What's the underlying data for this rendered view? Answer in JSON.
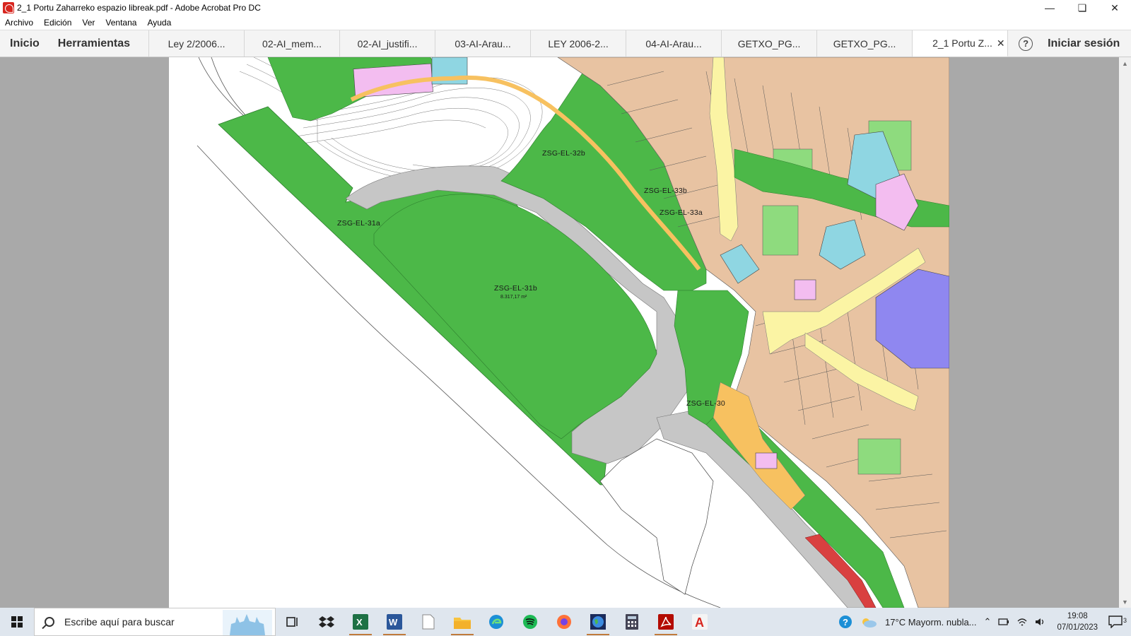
{
  "window": {
    "title": "2_1 Portu Zaharreko espazio libreak.pdf - Adobe Acrobat Pro DC"
  },
  "menu": [
    "Archivo",
    "Edición",
    "Ver",
    "Ventana",
    "Ayuda"
  ],
  "tabs": {
    "home": "Inicio",
    "tools": "Herramientas",
    "docs": [
      "Ley 2/2006...",
      "02-AI_mem...",
      "02-AI_justifi...",
      "03-AI-Arau...",
      "LEY 2006-2...",
      "04-AI-Arau...",
      "GETXO_PG...",
      "GETXO_PG..."
    ],
    "active": "2_1 Portu Z...",
    "help": "?",
    "signin": "Iniciar sesión"
  },
  "map": {
    "zones": [
      {
        "label": "ZSG-EL-32b"
      },
      {
        "label": "ZSG-EL-33b"
      },
      {
        "label": "ZSG-EL-33a"
      },
      {
        "label": "ZSG-EL-31a"
      },
      {
        "label": "ZSG-EL-31b",
        "area": "8.317,17 m²"
      },
      {
        "label": "ZSG-EL-30"
      }
    ],
    "colors": {
      "green": "#4cb848",
      "light_green": "#8edb7e",
      "parcel": "#e8c3a2",
      "road": "#c6c6c6",
      "street_yellow": "#fbf4a4",
      "orange": "#f7c160",
      "pink": "#f3bdf0",
      "cyan": "#8fd6e2",
      "purple": "#8f87f0"
    }
  },
  "taskbar": {
    "search_placeholder": "Escribe aquí para buscar",
    "weather": "17°C  Mayorm. nubla...",
    "time": "19:08",
    "date": "07/01/2023",
    "notifications": "3"
  }
}
